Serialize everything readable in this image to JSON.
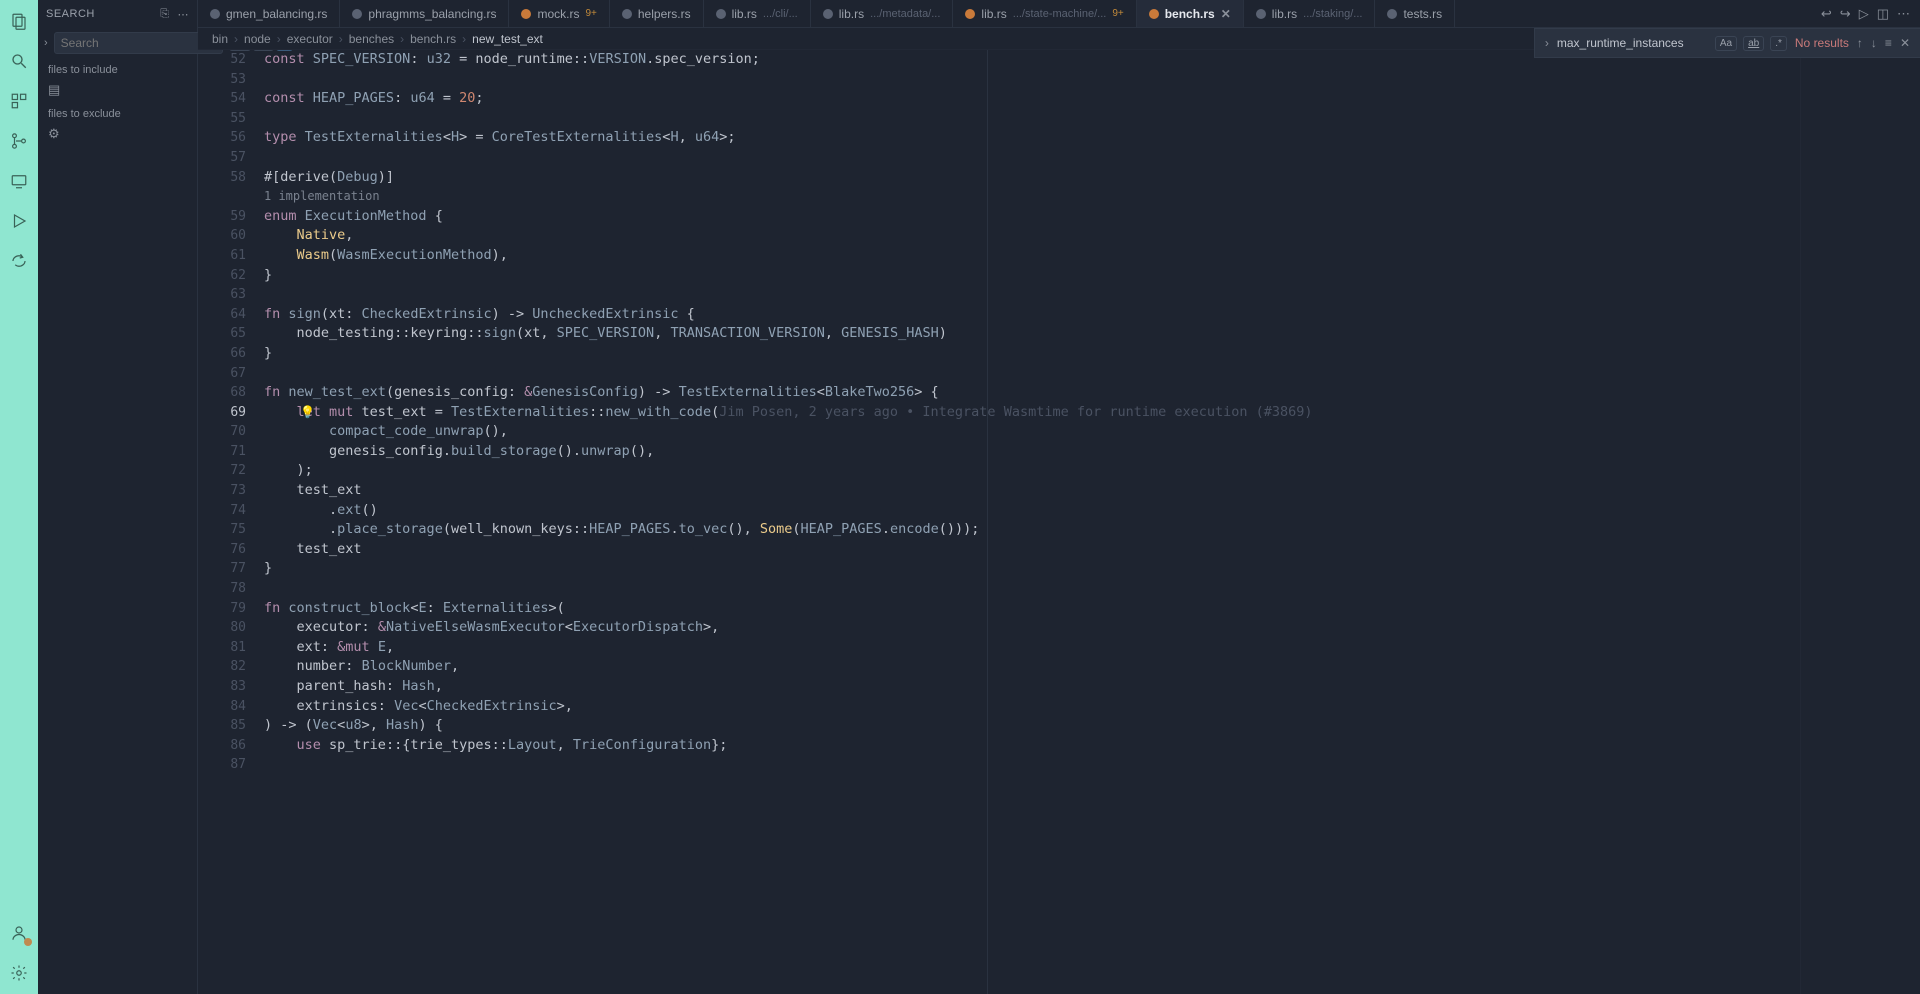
{
  "activity": {
    "account_badge": "1"
  },
  "search_panel": {
    "title": "SEARCH",
    "placeholder": "Search",
    "include_label": "files to include",
    "exclude_label": "files to exclude"
  },
  "tabs": [
    {
      "icon": "plain",
      "label": "gmen_balancing.rs",
      "hint": "",
      "dirty": ""
    },
    {
      "icon": "plain",
      "label": "phragmms_balancing.rs",
      "hint": "",
      "dirty": ""
    },
    {
      "icon": "rust",
      "label": "mock.rs",
      "hint": "",
      "dirty": "9+"
    },
    {
      "icon": "plain",
      "label": "helpers.rs",
      "hint": "",
      "dirty": ""
    },
    {
      "icon": "plain",
      "label": "lib.rs",
      "hint": ".../cli/...",
      "dirty": ""
    },
    {
      "icon": "plain",
      "label": "lib.rs",
      "hint": ".../metadata/...",
      "dirty": ""
    },
    {
      "icon": "rust",
      "label": "lib.rs",
      "hint": ".../state-machine/...",
      "dirty": "9+"
    },
    {
      "icon": "rust",
      "label": "bench.rs",
      "hint": "",
      "dirty": "",
      "active": true,
      "closable": true
    },
    {
      "icon": "plain",
      "label": "lib.rs",
      "hint": ".../staking/...",
      "dirty": ""
    },
    {
      "icon": "plain",
      "label": "tests.rs",
      "hint": "",
      "dirty": ""
    }
  ],
  "breadcrumb": [
    "bin",
    "node",
    "executor",
    "benches",
    "bench.rs",
    "new_test_ext"
  ],
  "find": {
    "query": "max_runtime_instances",
    "result": "No results"
  },
  "codelens": "1 implementation",
  "blame": "Jim Posen, 2 years ago • Integrate Wasmtime for runtime execution (#3869)",
  "lines": [
    {
      "n": 52,
      "seg": [
        [
          "kw",
          "const "
        ],
        [
          "ty",
          "SPEC_VERSION"
        ],
        [
          "op",
          ": "
        ],
        [
          "ty",
          "u32"
        ],
        [
          "op",
          " = "
        ],
        [
          "id",
          "node_runtime"
        ],
        [
          "op",
          "::"
        ],
        [
          "ty",
          "VERSION"
        ],
        [
          "op",
          "."
        ],
        [
          "id",
          "spec_version"
        ],
        [
          "op",
          ";"
        ]
      ]
    },
    {
      "n": 53,
      "seg": []
    },
    {
      "n": 54,
      "seg": [
        [
          "kw",
          "const "
        ],
        [
          "ty",
          "HEAP_PAGES"
        ],
        [
          "op",
          ": "
        ],
        [
          "ty",
          "u64"
        ],
        [
          "op",
          " = "
        ],
        [
          "cn",
          "20"
        ],
        [
          "op",
          ";"
        ]
      ]
    },
    {
      "n": 55,
      "seg": []
    },
    {
      "n": 56,
      "seg": [
        [
          "kw",
          "type "
        ],
        [
          "ty",
          "TestExternalities"
        ],
        [
          "op",
          "<"
        ],
        [
          "ty",
          "H"
        ],
        [
          "op",
          "> = "
        ],
        [
          "ty",
          "CoreTestExternalities"
        ],
        [
          "op",
          "<"
        ],
        [
          "ty",
          "H"
        ],
        [
          "op",
          ", "
        ],
        [
          "ty",
          "u64"
        ],
        [
          "op",
          ">;"
        ]
      ]
    },
    {
      "n": 57,
      "seg": []
    },
    {
      "n": 58,
      "seg": [
        [
          "attr",
          "#[derive("
        ],
        [
          "ty",
          "Debug"
        ],
        [
          "attr",
          ")]"
        ]
      ]
    },
    {
      "lens": true
    },
    {
      "n": 59,
      "seg": [
        [
          "kw",
          "enum "
        ],
        [
          "ty",
          "ExecutionMethod"
        ],
        [
          "op",
          " {"
        ]
      ]
    },
    {
      "n": 60,
      "fold": true,
      "seg": [
        [
          "op",
          "    "
        ],
        [
          "en",
          "Native"
        ],
        [
          "op",
          ","
        ]
      ]
    },
    {
      "n": 61,
      "fold": true,
      "seg": [
        [
          "op",
          "    "
        ],
        [
          "en",
          "Wasm"
        ],
        [
          "op",
          "("
        ],
        [
          "ty",
          "WasmExecutionMethod"
        ],
        [
          "op",
          "),"
        ]
      ]
    },
    {
      "n": 62,
      "fold": true,
      "seg": [
        [
          "op",
          "}"
        ]
      ]
    },
    {
      "n": 63,
      "seg": []
    },
    {
      "n": 64,
      "seg": [
        [
          "kw",
          "fn "
        ],
        [
          "fn",
          "sign"
        ],
        [
          "op",
          "(xt: "
        ],
        [
          "ty",
          "CheckedExtrinsic"
        ],
        [
          "op",
          ") -> "
        ],
        [
          "ty",
          "UncheckedExtrinsic"
        ],
        [
          "op",
          " {"
        ]
      ]
    },
    {
      "n": 65,
      "fold": true,
      "seg": [
        [
          "op",
          "    "
        ],
        [
          "id",
          "node_testing"
        ],
        [
          "op",
          "::"
        ],
        [
          "id",
          "keyring"
        ],
        [
          "op",
          "::"
        ],
        [
          "fn",
          "sign"
        ],
        [
          "op",
          "(xt, "
        ],
        [
          "ty",
          "SPEC_VERSION"
        ],
        [
          "op",
          ", "
        ],
        [
          "ty",
          "TRANSACTION_VERSION"
        ],
        [
          "op",
          ", "
        ],
        [
          "ty",
          "GENESIS_HASH"
        ],
        [
          "op",
          ")"
        ]
      ]
    },
    {
      "n": 66,
      "fold": true,
      "seg": [
        [
          "op",
          "}"
        ]
      ]
    },
    {
      "n": 67,
      "seg": []
    },
    {
      "n": 68,
      "seg": [
        [
          "kw",
          "fn "
        ],
        [
          "fn",
          "new_test_ext"
        ],
        [
          "op",
          "(genesis_config: "
        ],
        [
          "kw",
          "&"
        ],
        [
          "ty",
          "GenesisConfig"
        ],
        [
          "op",
          ") -> "
        ],
        [
          "ty",
          "TestExternalities"
        ],
        [
          "op",
          "<"
        ],
        [
          "ty",
          "BlakeTwo256"
        ],
        [
          "op",
          "> {"
        ]
      ]
    },
    {
      "n": 69,
      "hl": true,
      "bulb": true,
      "blame": true,
      "seg": [
        [
          "op",
          "    "
        ],
        [
          "kw",
          "let "
        ],
        [
          "kw",
          "mut "
        ],
        [
          "id",
          "test_ext"
        ],
        [
          "op",
          " = "
        ],
        [
          "ty",
          "TestExternalities"
        ],
        [
          "op",
          "::"
        ],
        [
          "fn",
          "new_with_code"
        ],
        [
          "op",
          "("
        ]
      ]
    },
    {
      "n": 70,
      "fold": true,
      "seg": [
        [
          "op",
          "        "
        ],
        [
          "fn",
          "compact_code_unwrap"
        ],
        [
          "op",
          "(),"
        ]
      ]
    },
    {
      "n": 71,
      "fold": true,
      "seg": [
        [
          "op",
          "        "
        ],
        [
          "id",
          "genesis_config"
        ],
        [
          "op",
          "."
        ],
        [
          "fn",
          "build_storage"
        ],
        [
          "op",
          "()."
        ],
        [
          "fn",
          "unwrap"
        ],
        [
          "op",
          "(),"
        ]
      ]
    },
    {
      "n": 72,
      "fold": true,
      "seg": [
        [
          "op",
          "    );"
        ]
      ]
    },
    {
      "n": 73,
      "fold": true,
      "seg": [
        [
          "op",
          "    "
        ],
        [
          "id",
          "test_ext"
        ]
      ]
    },
    {
      "n": 74,
      "fold": true,
      "seg": [
        [
          "op",
          "        ."
        ],
        [
          "fn",
          "ext"
        ],
        [
          "op",
          "()"
        ]
      ]
    },
    {
      "n": 75,
      "fold": true,
      "seg": [
        [
          "op",
          "        ."
        ],
        [
          "fn",
          "place_storage"
        ],
        [
          "op",
          "("
        ],
        [
          "id",
          "well_known_keys"
        ],
        [
          "op",
          "::"
        ],
        [
          "ty",
          "HEAP_PAGES"
        ],
        [
          "op",
          "."
        ],
        [
          "fn",
          "to_vec"
        ],
        [
          "op",
          "(), "
        ],
        [
          "en",
          "Some"
        ],
        [
          "op",
          "("
        ],
        [
          "ty",
          "HEAP_PAGES"
        ],
        [
          "op",
          "."
        ],
        [
          "fn",
          "encode"
        ],
        [
          "op",
          "()));"
        ]
      ]
    },
    {
      "n": 76,
      "fold": true,
      "seg": [
        [
          "op",
          "    "
        ],
        [
          "id",
          "test_ext"
        ]
      ]
    },
    {
      "n": 77,
      "fold": true,
      "seg": [
        [
          "op",
          "}"
        ]
      ]
    },
    {
      "n": 78,
      "seg": []
    },
    {
      "n": 79,
      "seg": [
        [
          "kw",
          "fn "
        ],
        [
          "fn",
          "construct_block"
        ],
        [
          "op",
          "<"
        ],
        [
          "ty",
          "E"
        ],
        [
          "op",
          ": "
        ],
        [
          "ty",
          "Externalities"
        ],
        [
          "op",
          ">("
        ]
      ]
    },
    {
      "n": 80,
      "fold": true,
      "seg": [
        [
          "op",
          "    "
        ],
        [
          "id",
          "executor"
        ],
        [
          "op",
          ": "
        ],
        [
          "kw",
          "&"
        ],
        [
          "ty",
          "NativeElseWasmExecutor"
        ],
        [
          "op",
          "<"
        ],
        [
          "ty",
          "ExecutorDispatch"
        ],
        [
          "op",
          ">,"
        ]
      ]
    },
    {
      "n": 81,
      "fold": true,
      "seg": [
        [
          "op",
          "    "
        ],
        [
          "id",
          "ext"
        ],
        [
          "op",
          ": "
        ],
        [
          "kw",
          "&mut "
        ],
        [
          "ty",
          "E"
        ],
        [
          "op",
          ","
        ]
      ]
    },
    {
      "n": 82,
      "fold": true,
      "seg": [
        [
          "op",
          "    "
        ],
        [
          "id",
          "number"
        ],
        [
          "op",
          ": "
        ],
        [
          "ty",
          "BlockNumber"
        ],
        [
          "op",
          ","
        ]
      ]
    },
    {
      "n": 83,
      "fold": true,
      "seg": [
        [
          "op",
          "    "
        ],
        [
          "id",
          "parent_hash"
        ],
        [
          "op",
          ": "
        ],
        [
          "ty",
          "Hash"
        ],
        [
          "op",
          ","
        ]
      ]
    },
    {
      "n": 84,
      "fold": true,
      "seg": [
        [
          "op",
          "    "
        ],
        [
          "id",
          "extrinsics"
        ],
        [
          "op",
          ": "
        ],
        [
          "ty",
          "Vec"
        ],
        [
          "op",
          "<"
        ],
        [
          "ty",
          "CheckedExtrinsic"
        ],
        [
          "op",
          ">,"
        ]
      ]
    },
    {
      "n": 85,
      "fold": true,
      "seg": [
        [
          "op",
          ") -> ("
        ],
        [
          "ty",
          "Vec"
        ],
        [
          "op",
          "<"
        ],
        [
          "ty",
          "u8"
        ],
        [
          "op",
          ">, "
        ],
        [
          "ty",
          "Hash"
        ],
        [
          "op",
          ") {"
        ]
      ]
    },
    {
      "n": 86,
      "fold": true,
      "seg": [
        [
          "op",
          "    "
        ],
        [
          "kw",
          "use "
        ],
        [
          "id",
          "sp_trie"
        ],
        [
          "op",
          "::{"
        ],
        [
          "id",
          "trie_types"
        ],
        [
          "op",
          "::"
        ],
        [
          "ty",
          "Layout"
        ],
        [
          "op",
          ", "
        ],
        [
          "ty",
          "TrieConfiguration"
        ],
        [
          "op",
          "};"
        ]
      ]
    },
    {
      "n": 87,
      "seg": []
    }
  ]
}
